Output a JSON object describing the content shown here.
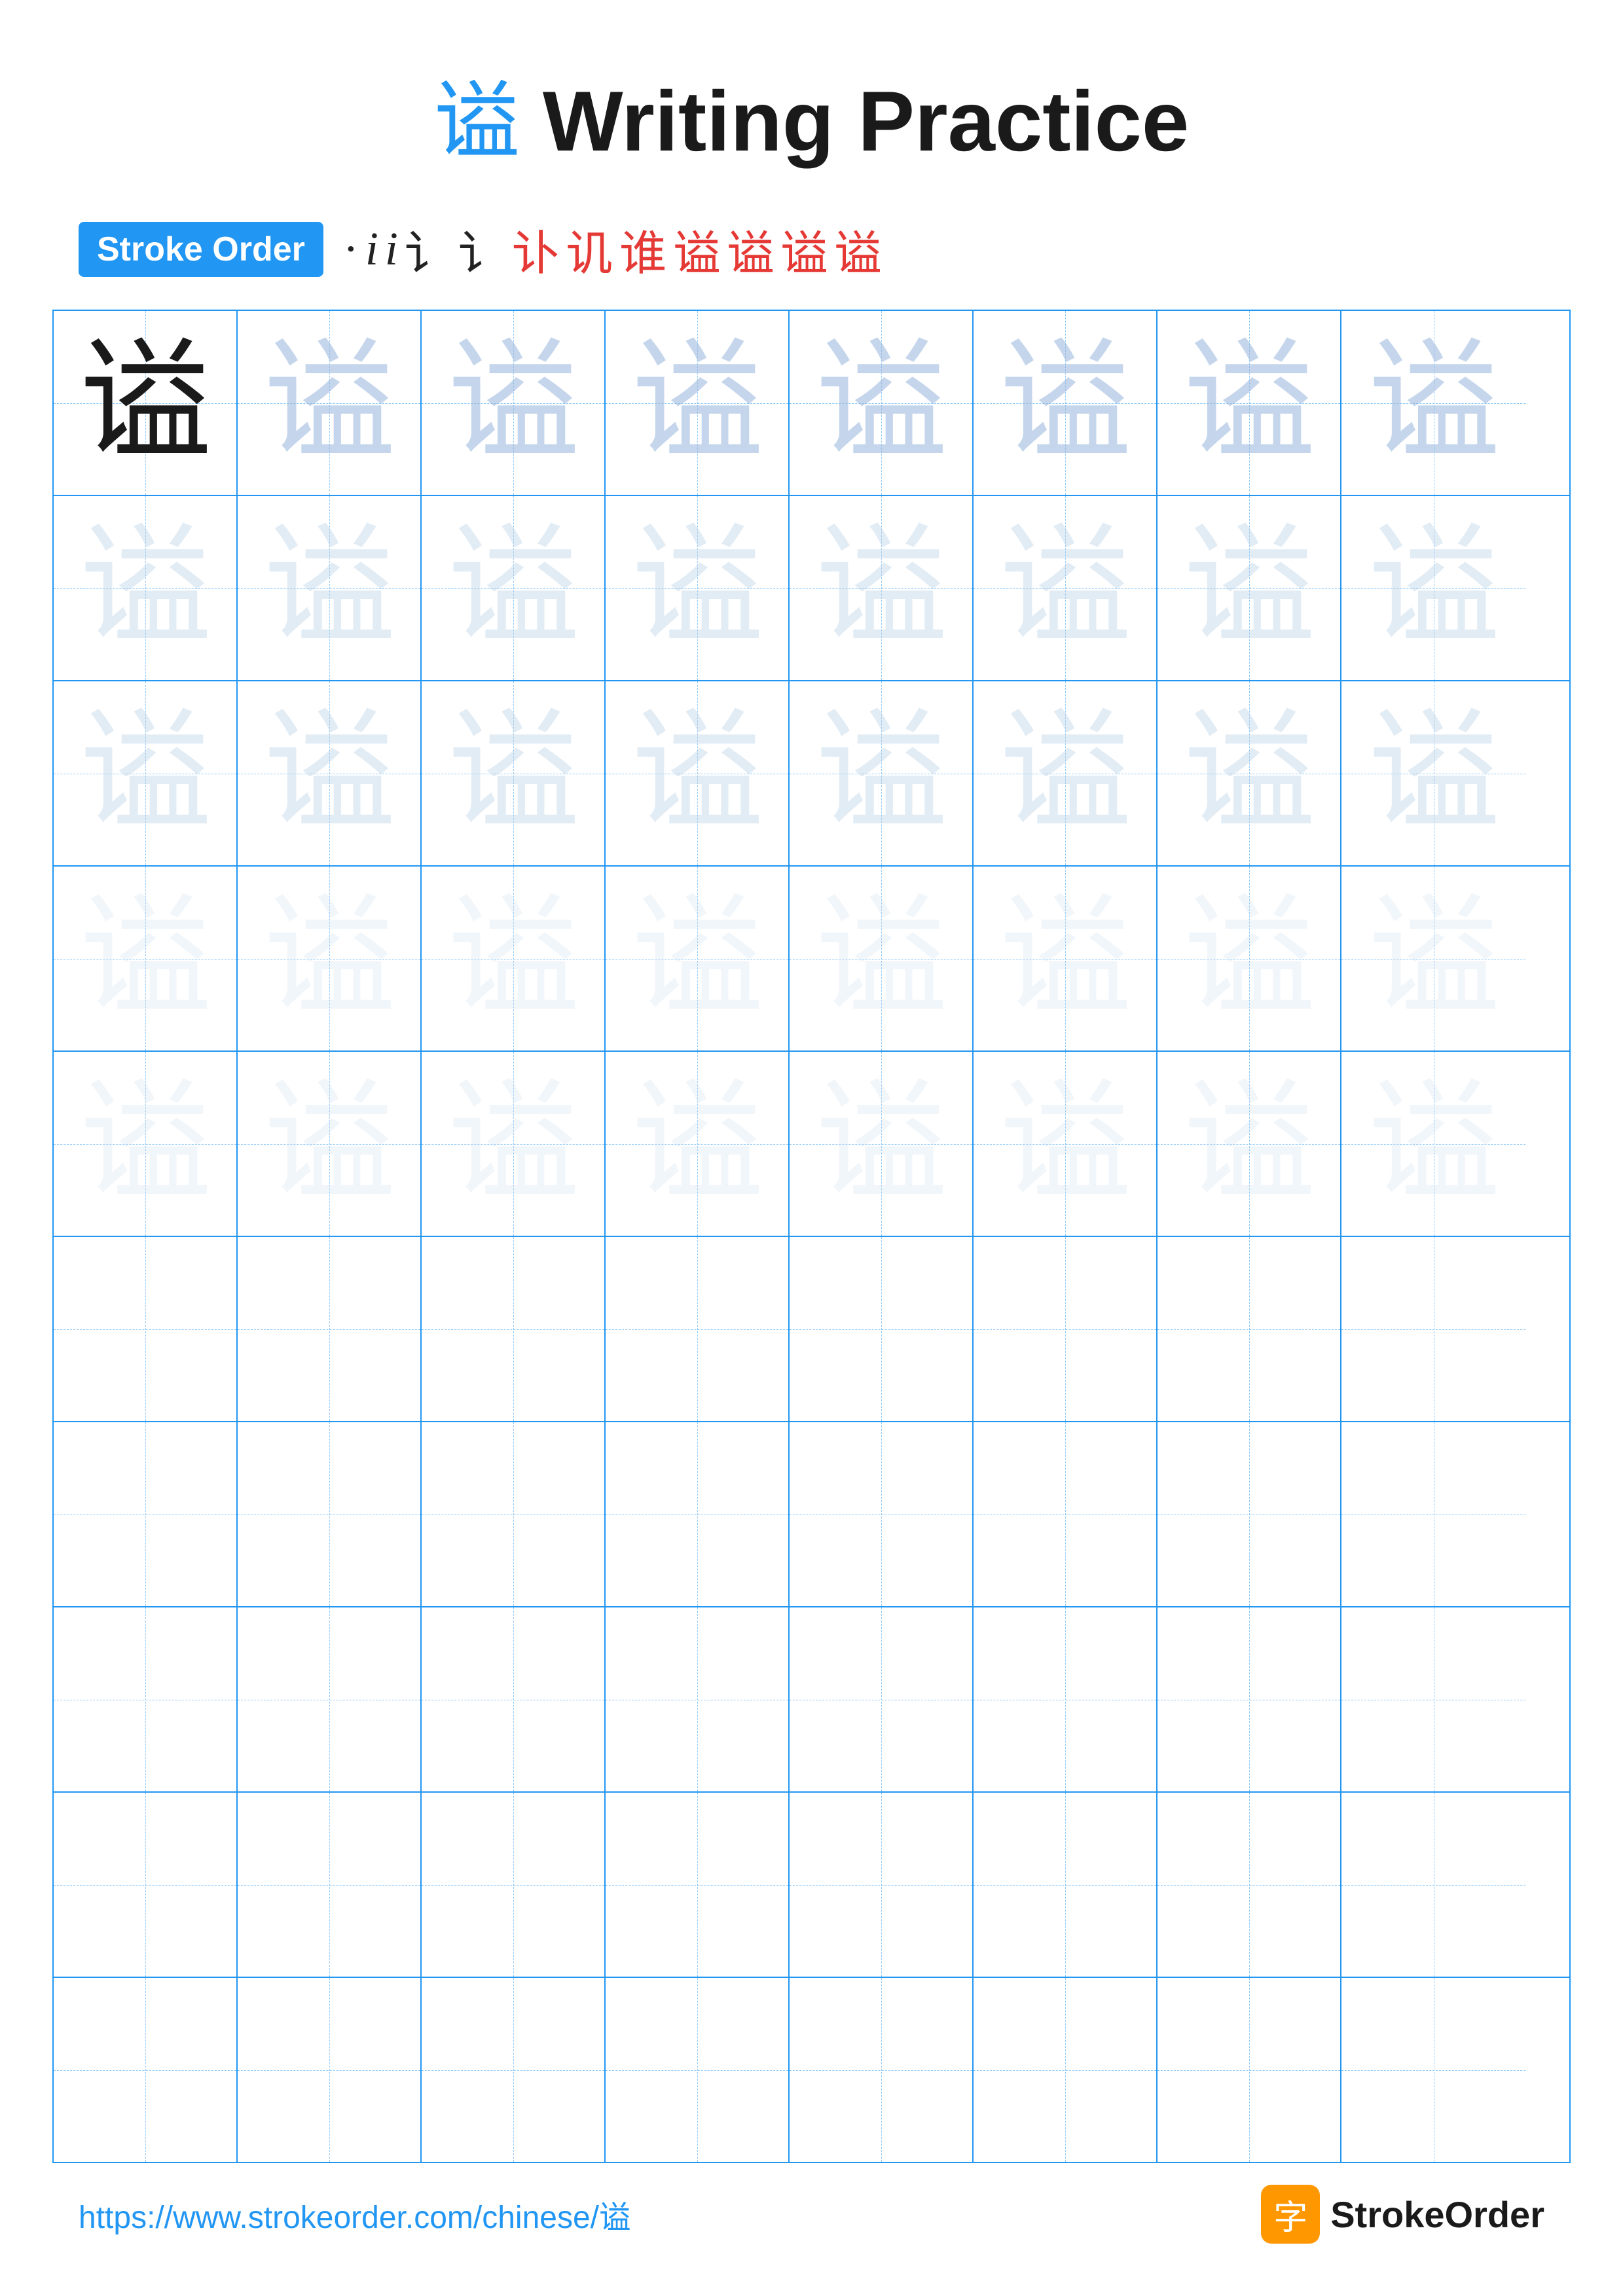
{
  "title": {
    "char": "谥",
    "text": " Writing Practice"
  },
  "stroke_order": {
    "badge_label": "Stroke Order",
    "strokes": [
      "·",
      "i",
      "i",
      "讠",
      "讠",
      "讣",
      "讥",
      "谁",
      "谁",
      "谥",
      "谥",
      "谥"
    ]
  },
  "grid": {
    "rows": 10,
    "cols": 8,
    "char": "谥",
    "filled_rows": 5,
    "empty_rows": 5
  },
  "footer": {
    "url": "https://www.strokeorder.com/chinese/谥",
    "logo_char": "字",
    "logo_name": "StrokeOrder"
  }
}
